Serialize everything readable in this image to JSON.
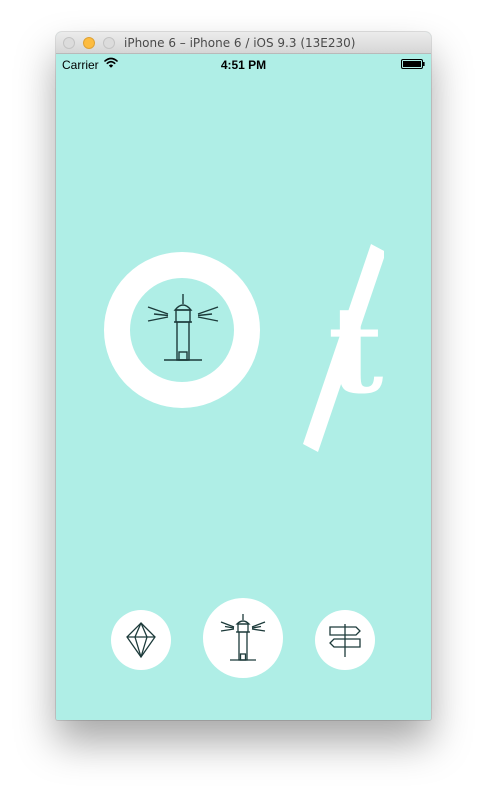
{
  "window": {
    "title": "iPhone 6 – iPhone 6 / iOS 9.3 (13E230)"
  },
  "status_bar": {
    "carrier": "Carrier",
    "time": "4:51 PM",
    "wifi_icon": "wifi-icon",
    "battery_icon": "battery-icon",
    "battery_level": 1.0
  },
  "logo": {
    "letter": "t",
    "icon": "lighthouse-icon"
  },
  "nav": {
    "items": [
      {
        "name": "gem",
        "icon": "diamond-icon"
      },
      {
        "name": "lighthouse",
        "icon": "lighthouse-icon",
        "selected": true
      },
      {
        "name": "signpost",
        "icon": "signpost-icon"
      }
    ]
  },
  "colors": {
    "background": "#afeee6",
    "foreground": "#ffffff",
    "icon_stroke": "#1c3a3a"
  }
}
